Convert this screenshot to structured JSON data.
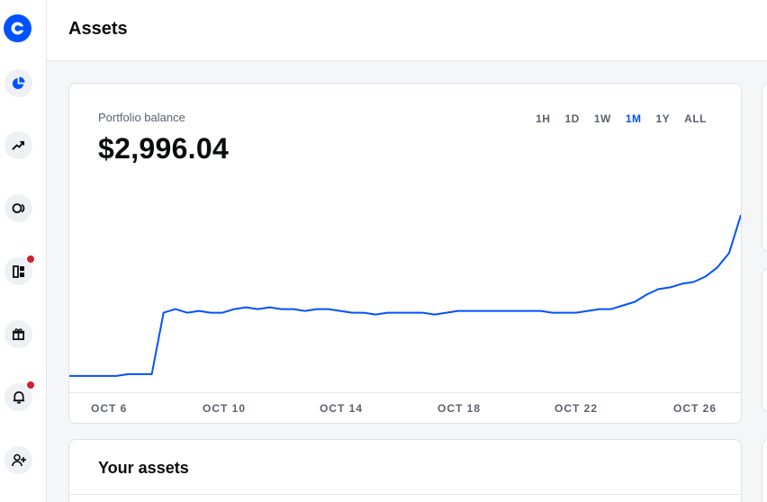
{
  "header": {
    "title": "Assets"
  },
  "sidebar": {
    "items": [
      {
        "name": "portfolio",
        "icon": "pie-chart-icon",
        "active": true
      },
      {
        "name": "trade",
        "icon": "trending-up-icon"
      },
      {
        "name": "earn",
        "icon": "earn-icon"
      },
      {
        "name": "dashboard",
        "icon": "dashboard-icon",
        "notification": true
      },
      {
        "name": "rewards",
        "icon": "gift-icon"
      },
      {
        "name": "notifications",
        "icon": "bell-icon",
        "notification": true
      },
      {
        "name": "invite",
        "icon": "add-user-icon"
      }
    ]
  },
  "portfolio": {
    "label": "Portfolio balance",
    "balance": "$2,996.04",
    "ranges": [
      "1H",
      "1D",
      "1W",
      "1M",
      "1Y",
      "ALL"
    ],
    "active_range": "1M"
  },
  "chart_data": {
    "type": "line",
    "series": [
      {
        "values": [
          0.07,
          0.07,
          0.07,
          0.07,
          0.07,
          0.08,
          0.08,
          0.08,
          0.42,
          0.44,
          0.42,
          0.43,
          0.42,
          0.42,
          0.44,
          0.45,
          0.44,
          0.45,
          0.44,
          0.44,
          0.43,
          0.44,
          0.44,
          0.43,
          0.42,
          0.42,
          0.41,
          0.42,
          0.42,
          0.42,
          0.42,
          0.41,
          0.42,
          0.43,
          0.43,
          0.43,
          0.43,
          0.43,
          0.43,
          0.43,
          0.43,
          0.42,
          0.42,
          0.42,
          0.43,
          0.44,
          0.44,
          0.46,
          0.48,
          0.52,
          0.55,
          0.56,
          0.58,
          0.59,
          0.62,
          0.67,
          0.75,
          0.96
        ]
      }
    ],
    "colors": {
      "line": "#0052ff"
    },
    "x_ticks": [
      "OCT 6",
      "OCT 10",
      "OCT 14",
      "OCT 18",
      "OCT 22",
      "OCT 26"
    ],
    "grid": false
  },
  "assets": {
    "title": "Your assets"
  },
  "colors": {
    "accent": "#0052ff",
    "badge": "#cf202f"
  }
}
